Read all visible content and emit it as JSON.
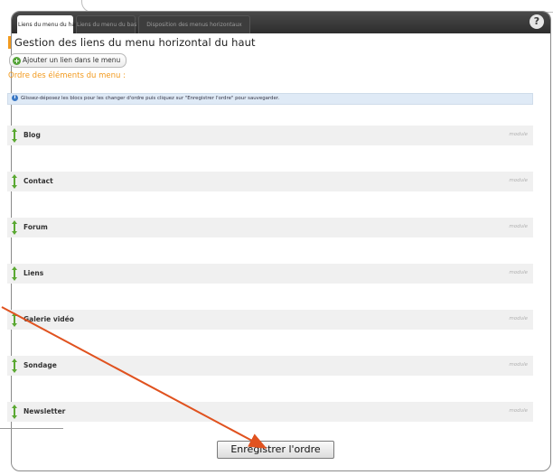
{
  "tabs": [
    {
      "label": "Liens du menu du haut",
      "active": true
    },
    {
      "label": "Liens du menu du bas",
      "active": false
    },
    {
      "label": "Disposition des menus horizontaux",
      "active": false
    }
  ],
  "help_label": "?",
  "page_title": "Gestion des liens du menu horizontal du haut",
  "add_link_label": "Ajouter un lien dans le menu",
  "section_label": "Ordre des éléments du menu :",
  "info_text": "Glissez-déposez les blocs pour les changer d'ordre puis cliquez sur \"Enregistrer l'ordre\" pour sauvegarder.",
  "items": [
    {
      "label": "Blog",
      "type": "module"
    },
    {
      "label": "Contact",
      "type": "module"
    },
    {
      "label": "Forum",
      "type": "module"
    },
    {
      "label": "Liens",
      "type": "module"
    },
    {
      "label": "Galerie vidéo",
      "type": "module"
    },
    {
      "label": "Sondage",
      "type": "module"
    },
    {
      "label": "Newsletter",
      "type": "module"
    }
  ],
  "save_label": "Enregistrer l'ordre",
  "colors": {
    "accent": "#f29a1e",
    "arrow": "#e0521f",
    "handle": "#5aa832",
    "tabbar": "#333333"
  }
}
